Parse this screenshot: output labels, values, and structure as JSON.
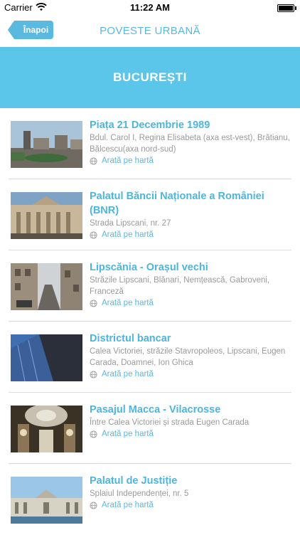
{
  "status_bar": {
    "carrier": "Carrier",
    "time": "11:22 AM"
  },
  "nav": {
    "back_label": "Înapoi",
    "title": "POVESTE URBANĂ"
  },
  "banner": {
    "title": "BUCUREȘTI"
  },
  "map_link_label": "Arată pe hartă",
  "colors": {
    "accent": "#5bb8df",
    "banner": "#5bc6ea",
    "address": "#9a9a9a"
  },
  "items": [
    {
      "title": "Piața 21 Decembrie 1989",
      "address": "Bdul. Carol I, Regina Elisabeta (axa est-vest), Brătianu, Bălcescu(axa nord-sud)"
    },
    {
      "title": "Palatul Băncii Naționale a României (BNR)",
      "address": "Strada Lipscani, nr. 27"
    },
    {
      "title": "Lipscănia - Orașul vechi",
      "address": "Străzile Lipscani, Blănari, Nemțească, Gabroveni, Franceză"
    },
    {
      "title": "Districtul bancar",
      "address": "Calea Victoriei, străzile Stavropoleos, Lipscani, Eugen Carada, Doamnei, Ion Ghica"
    },
    {
      "title": "Pasajul Macca - Vilacrosse",
      "address": "Între Calea Victoriei și strada Eugen Carada"
    },
    {
      "title": "Palatul de Justiție",
      "address": "Splaiul Independenței, nr. 5"
    }
  ]
}
